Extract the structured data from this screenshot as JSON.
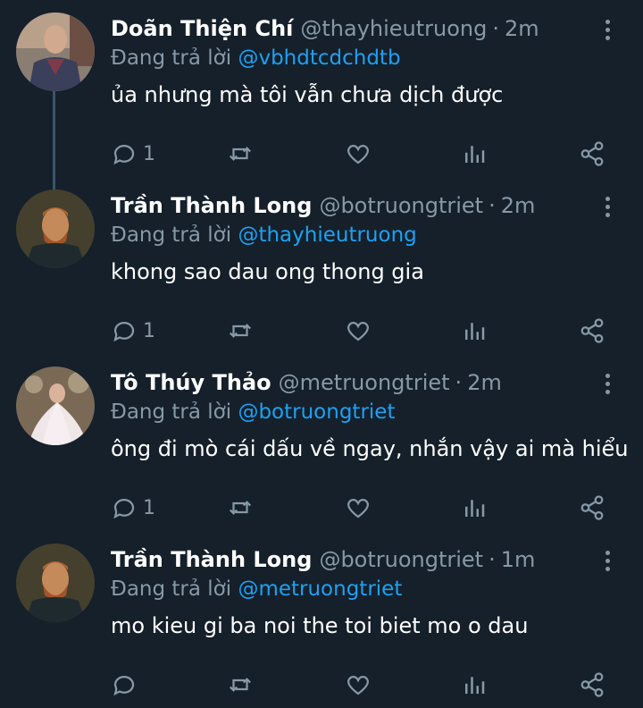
{
  "reply_prefix": "Đang trả lời",
  "tweets": [
    {
      "name": "Doãn Thiện Chí",
      "handle": "@thayhieutruong",
      "time": "2m",
      "reply_to": "@vbhdtcdchdtb",
      "text": "ủa nhưng mà tôi vẫn chưa dịch được",
      "reply_count": "1",
      "avatar": "man-in-vest-avatar"
    },
    {
      "name": "Trần Thành Long",
      "handle": "@botruongtriet",
      "time": "2m",
      "reply_to": "@thayhieutruong",
      "text": "khong sao dau ong thong gia",
      "reply_count": "1",
      "avatar": "painted-portrait-avatar"
    },
    {
      "name": "Tô Thúy Thảo",
      "handle": "@metruongtriet",
      "time": "2m",
      "reply_to": "@botruongtriet",
      "text": "ông đi mò cái dấu về ngay, nhắn vậy ai mà hiểu",
      "reply_count": "1",
      "avatar": "bride-dress-avatar"
    },
    {
      "name": "Trần Thành Long",
      "handle": "@botruongtriet",
      "time": "1m",
      "reply_to": "@metruongtriet",
      "text": "mo kieu gi ba noi the toi biet mo o dau",
      "reply_count": "",
      "avatar": "painted-portrait-avatar"
    }
  ],
  "colors": {
    "background": "#15202b",
    "text": "#ffffff",
    "muted": "#8899a6",
    "link": "#1da1f2",
    "thread_line": "#3d5466"
  }
}
